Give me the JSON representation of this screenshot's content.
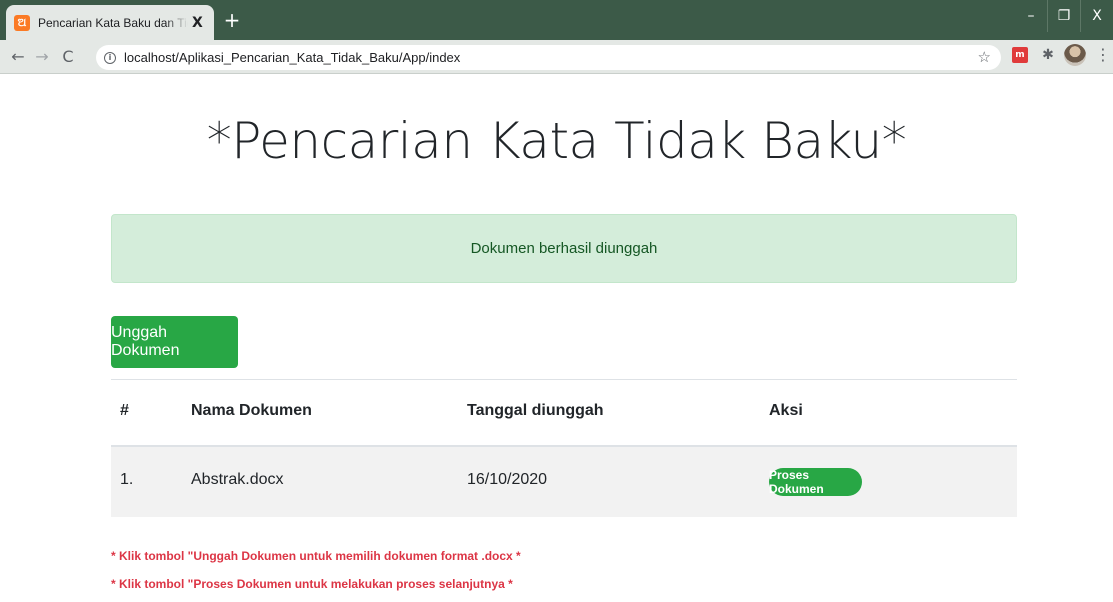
{
  "browser": {
    "tab_title": "Pencarian Kata Baku dan Tidak Baku",
    "tab_close": "X",
    "new_tab": "+",
    "url": "localhost/Aplikasi_Pencarian_Kata_Tidak_Baku/App/index",
    "window_controls": {
      "minimize": "–",
      "maximize": "❐",
      "close": "X"
    },
    "icons": [
      "xampp-favicon",
      "back-icon",
      "forward-icon",
      "reload-icon",
      "info-icon",
      "star-icon",
      "extension-icon",
      "puzzle-icon",
      "profile-avatar",
      "menu-icon"
    ]
  },
  "page": {
    "title": "*Pencarian Kata Tidak Baku*",
    "alert": "Dokumen berhasil diunggah",
    "upload_button": "Unggah Dokumen",
    "table": {
      "headers": [
        "#",
        "Nama Dokumen",
        "Tanggal diunggah",
        "Aksi"
      ],
      "rows": [
        {
          "no": "1.",
          "name": "Abstrak.docx",
          "date": "16/10/2020",
          "action": "Proses Dokumen"
        }
      ]
    },
    "notes": [
      "* Klik tombol \"Unggah Dokumen untuk memilih dokumen format .docx *",
      "* Klik tombol \"Proses Dokumen untuk melakukan proses selanjutnya *"
    ]
  },
  "colors": {
    "accent_green": "#28a745",
    "alert_bg": "#d4edda",
    "note_red": "#dc3545",
    "tabbar": "#3c5a48"
  }
}
